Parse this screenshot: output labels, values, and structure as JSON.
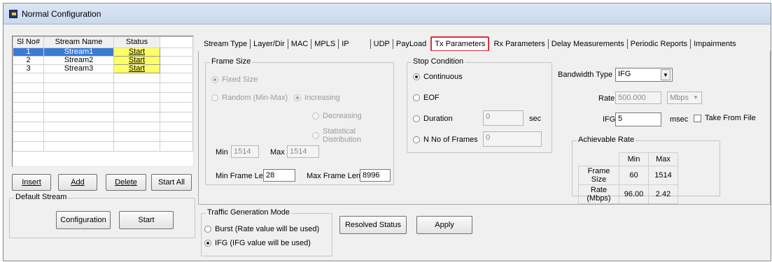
{
  "window": {
    "title": "Normal Configuration"
  },
  "stream_table": {
    "headers": [
      "Sl No#",
      "Stream Name",
      "Status"
    ],
    "rows": [
      {
        "no": "1",
        "name": "Stream1",
        "status": "Start"
      },
      {
        "no": "2",
        "name": "Stream2",
        "status": "Start"
      },
      {
        "no": "3",
        "name": "Stream3",
        "status": "Start"
      }
    ]
  },
  "stream_buttons": {
    "insert": "Insert",
    "add": "Add",
    "delete": "Delete",
    "start_all": "Start All"
  },
  "default_stream": {
    "legend": "Default Stream",
    "configuration": "Configuration",
    "start": "Start"
  },
  "tabs": [
    "Stream Type",
    "Layer/Dir",
    "MAC",
    "MPLS",
    "IP",
    "UDP",
    "PayLoad",
    "Tx Parameters",
    "Rx Parameters",
    "Delay Measurements",
    "Periodic Reports",
    "Impairments"
  ],
  "active_tab": "Tx Parameters",
  "frame_size": {
    "legend": "Frame Size",
    "fixed": "Fixed Size",
    "random": "Random (Min-Max)",
    "increasing": "Increasing",
    "decreasing": "Decreasing",
    "statistical": "Statistical Distribution",
    "min_label": "Min",
    "min_value": "1514",
    "max_label": "Max",
    "max_value": "1514",
    "min_frame_len_label": "Min Frame Len",
    "min_frame_len_value": "28",
    "max_frame_len_label": "Max Frame Len",
    "max_frame_len_value": "8996"
  },
  "stop_condition": {
    "legend": "Stop Condition",
    "continuous": "Continuous",
    "eof": "EOF",
    "duration": "Duration",
    "duration_value": "0",
    "duration_unit": "sec",
    "n_frames": "N No of Frames",
    "n_frames_value": "0"
  },
  "bandwidth": {
    "type_label": "Bandwidth Type",
    "type_value": "IFG",
    "rate_label": "Rate",
    "rate_value": "500.000",
    "rate_unit": "Mbps",
    "ifg_label": "IFG",
    "ifg_value": "5",
    "ifg_unit": "msec",
    "take_from_file": "Take From File"
  },
  "achievable_rate": {
    "legend": "Achievable Rate",
    "col_min": "Min",
    "col_max": "Max",
    "frame_size_label": "Frame Size",
    "frame_size_min": "60",
    "frame_size_max": "1514",
    "rate_label": "Rate (Mbps)",
    "rate_min": "96.00",
    "rate_max": "2.42"
  },
  "traffic_mode": {
    "legend": "Traffic Generation Mode",
    "burst": "Burst (Rate value will be used)",
    "ifg": "IFG (IFG value will be used)"
  },
  "actions": {
    "resolved_status": "Resolved Status",
    "apply": "Apply"
  },
  "colors": {
    "status_start_bg": "#ffff66",
    "selected_row_bg": "#3a7bd5",
    "tab_highlight": "#d9303b"
  }
}
